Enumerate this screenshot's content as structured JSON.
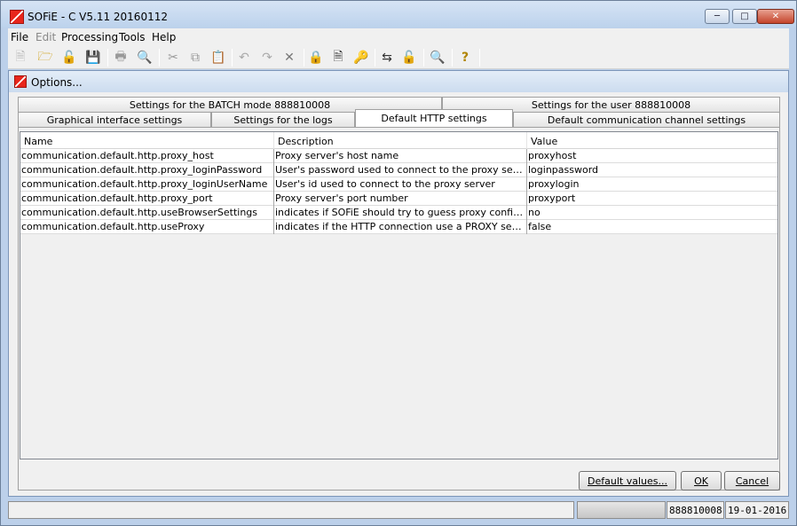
{
  "window": {
    "title": "SOFiE - C V5.11 20160112"
  },
  "menu": [
    {
      "label": "File",
      "disabled": false
    },
    {
      "label": "Edit",
      "disabled": true
    },
    {
      "label": "Processing",
      "disabled": false
    },
    {
      "label": "Tools",
      "disabled": false
    },
    {
      "label": "Help",
      "disabled": false
    }
  ],
  "toolbar": {
    "icons": [
      "new-file-icon",
      "open-folder-icon",
      "unlock-open-icon",
      "save-icon",
      "print-icon",
      "print-preview-icon",
      "cut-icon",
      "copy-icon",
      "paste-icon",
      "undo-icon",
      "redo-icon",
      "delete-icon",
      "lock-icon",
      "document-settings-icon",
      "document-key-icon",
      "connection-icon",
      "unlock-icon",
      "find-icon",
      "help-icon"
    ]
  },
  "dialog": {
    "title": "Options...",
    "tabs_row1": [
      "Settings for the BATCH mode 888810008",
      "Settings for the user 888810008"
    ],
    "tabs_row2": [
      "Graphical interface settings",
      "Settings for the logs",
      "Default HTTP settings",
      "Default communication channel settings"
    ],
    "active_tab": "Default HTTP settings",
    "columns": [
      "Name",
      "Description",
      "Value"
    ],
    "rows": [
      [
        "communication.default.http.proxy_host",
        "Proxy server's host name",
        "proxyhost"
      ],
      [
        "communication.default.http.proxy_loginPassword",
        "User's password used to connect to the proxy server",
        "loginpassword"
      ],
      [
        "communication.default.http.proxy_loginUserName",
        "User's id used to connect to the proxy server",
        "proxylogin"
      ],
      [
        "communication.default.http.proxy_port",
        "Proxy server's port number",
        "proxyport"
      ],
      [
        "communication.default.http.useBrowserSettings",
        "indicates if SOFiE should try to guess proxy configuratio...",
        "no"
      ],
      [
        "communication.default.http.useProxy",
        "indicates if the HTTP connection use a PROXY server",
        "false"
      ]
    ],
    "buttons": {
      "defaults": "Default values...",
      "ok": "OK",
      "cancel": "Cancel"
    }
  },
  "statusbar": {
    "message": "",
    "progress": "",
    "user": "888810008",
    "date": "19-01-2016"
  }
}
